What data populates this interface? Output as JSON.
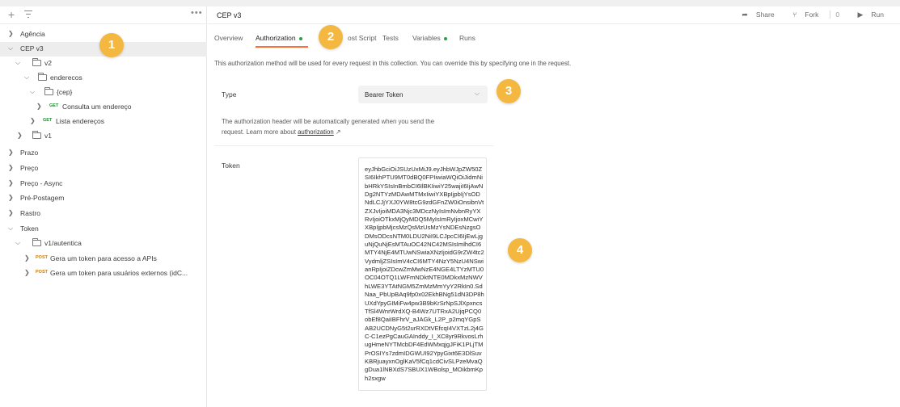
{
  "sidebar": {
    "items": [
      {
        "label": "Agência",
        "indent": 0,
        "expanded": false
      },
      {
        "label": "CEP v3",
        "indent": 0,
        "expanded": true,
        "selected": true
      },
      {
        "label": "v2",
        "indent": 1,
        "expanded": true,
        "folder": true
      },
      {
        "label": "enderecos",
        "indent": 2,
        "expanded": true,
        "folder": true
      },
      {
        "label": "{cep}",
        "indent": 3,
        "expanded": true,
        "folder": true
      },
      {
        "label": "Consulta um endereço",
        "indent": 4,
        "method": "GET"
      },
      {
        "label": "Lista endereços",
        "indent": 3,
        "method": "GET"
      },
      {
        "label": "v1",
        "indent": 1,
        "expanded": false,
        "folder": true
      },
      {
        "label": "Prazo",
        "indent": 0,
        "expanded": false
      },
      {
        "label": "Preço",
        "indent": 0,
        "expanded": false
      },
      {
        "label": "Preço - Async",
        "indent": 0,
        "expanded": false
      },
      {
        "label": "Pré-Postagem",
        "indent": 0,
        "expanded": false
      },
      {
        "label": "Rastro",
        "indent": 0,
        "expanded": false
      },
      {
        "label": "Token",
        "indent": 0,
        "expanded": true
      },
      {
        "label": "v1/autentica",
        "indent": 1,
        "expanded": true,
        "folder": true
      },
      {
        "label": "Gera um token para acesso a APIs",
        "indent": 2,
        "method": "POST"
      },
      {
        "label": "Gera um token para usuários externos (idC...",
        "indent": 2,
        "method": "POST"
      }
    ]
  },
  "header": {
    "title": "CEP v3",
    "share_label": "Share",
    "fork_label": "Fork",
    "fork_count": "0",
    "run_label": "Run"
  },
  "tabs": {
    "overview": "Overview",
    "authorization": "Authorization",
    "post_script_partial": "ost Script",
    "tests": "Tests",
    "variables": "Variables",
    "runs": "Runs"
  },
  "info_text": "This authorization method will be used for every request in this collection. You can override this by specifying one in the request.",
  "auth": {
    "type_label": "Type",
    "type_value": "Bearer Token",
    "desc_line1": "The authorization header will be automatically generated when you send the",
    "desc_line2_prefix": "request. Learn more about ",
    "desc_link": "authorization",
    "desc_arrow": "↗",
    "token_label": "Token",
    "token_value": "eyJhbGciOiJSUzUxMiJ9.eyJhbWJpZW50ZSI6IkhPTU9MT0dBQ0FPIiwiaWQiOiJidmNibHRkYSIsInBmbCI6IlBKIiwiY25wajiI6IjAwNDg2NTYzMDAwMTMxIiwiYXBpIjpbIjYsODNdLCJjYXJ0YW8tcG9zdGFnZW0iOnsibnVtZXJvIjoiMDA3Njc3MDczNyIsImNvbnRyYXRvIjoiOTkxMjQyMDQ5MyIsImRyIjoxMCwiYXBpIjpbMjcsMzQsMzUsMzYsNDEsNzgsODMsODcsNTM0LDU2NiI9LCJpcCI6IjEwLjguNjQuNjEsMTAuOC42NC42MSIsImlhdCI6MTY4NjE4MTUwNSwiaXNzIjoidG9rZW4tc2VydmljZSIsImV4cCI6MTY4NzY5NzU4NSwianRpIjoiZDcwZmMwNzE4NGE4LTYzMTU0OC04OTQ1LWFmNDktNTE0MDkxMzNWVhLWE3YTAtNGM5ZmMzMmYyY2RkIn0.SdNaa_PbUpBAq9fp0x02EkhBNg51dN3DP8hUXdYpyGIMiFw4pw3B9bKrSrNpSJlXpxncsTfSl4WnrWrdXQ-B4Wz7UTRxA2UjqPCQ0obEf8QaiIBFhrV_aJAGk_L2P_p2mqYGpSAB2UCDNyG5t2urRXDtVEfcqI4VXTzL2j4GC-C1ezPgCauGAInddy_I_XC8yr9RkvosLrhugHmeNYTMcbDF4EdWMxqjgJFiK1PLjTMPrOSIYs7zdmIDGWUI92YpyGixt6E3DlSuvKBRjuayxnOglKaV5fCq1cdCivSLPzeMvaQgDua1lNBXdS7SBUX1WBolsp_MOikbmKph2sxgw"
  },
  "callouts": [
    "1",
    "2",
    "3",
    "4"
  ],
  "colors": {
    "accent": "#ff6c37",
    "callout": "#f4b73f",
    "get": "#1a8a2e",
    "post": "#c77d0a",
    "variables_dot": "#27a146"
  }
}
